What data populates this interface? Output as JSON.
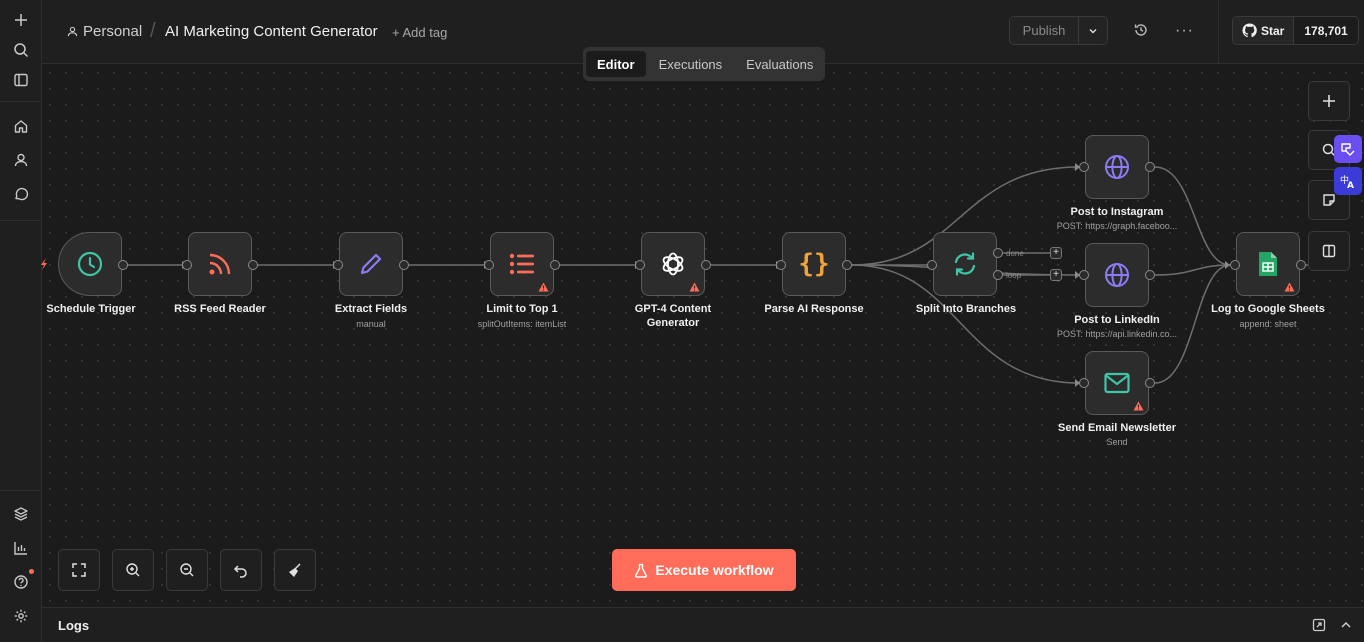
{
  "header": {
    "project": "Personal",
    "workflow_title": "AI Marketing Content Generator",
    "add_tag": "+ Add tag",
    "publish": "Publish",
    "github_star": "Star",
    "github_count": "178,701"
  },
  "tabs": [
    {
      "label": "Editor",
      "active": true
    },
    {
      "label": "Executions",
      "active": false
    },
    {
      "label": "Evaluations",
      "active": false
    }
  ],
  "nodes": [
    {
      "id": "schedule",
      "label": "Schedule Trigger",
      "sub": "",
      "icon": "clock-icon",
      "color": "#3fc5a8",
      "warning": false
    },
    {
      "id": "rss",
      "label": "RSS Feed Reader",
      "sub": "",
      "icon": "rss-icon",
      "color": "#ff6d5a",
      "warning": false
    },
    {
      "id": "extract",
      "label": "Extract Fields",
      "sub": "manual",
      "icon": "pencil-icon",
      "color": "#8b7cf6",
      "warning": false
    },
    {
      "id": "limit",
      "label": "Limit to Top 1",
      "sub": "splitOutItems: itemList",
      "icon": "list-icon",
      "color": "#ff6d5a",
      "warning": true
    },
    {
      "id": "gpt",
      "label": "GPT-4 Content Generator",
      "sub": "",
      "icon": "openai-icon",
      "color": "#ffffff",
      "warning": true
    },
    {
      "id": "parse",
      "label": "Parse AI Response",
      "sub": "",
      "icon": "braces-icon",
      "color": "#f2a23a",
      "warning": false
    },
    {
      "id": "split",
      "label": "Split Into Branches",
      "sub": "",
      "icon": "loop-icon",
      "color": "#3fc5a8",
      "warning": false
    },
    {
      "id": "instagram",
      "label": "Post to Instagram",
      "sub": "POST: https://graph.faceboo...",
      "icon": "globe-icon",
      "color": "#8b7cf6",
      "warning": false
    },
    {
      "id": "linkedin",
      "label": "Post to LinkedIn",
      "sub": "POST: https://api.linkedin.co...",
      "icon": "globe-icon",
      "color": "#8b7cf6",
      "warning": false
    },
    {
      "id": "email",
      "label": "Send Email Newsletter",
      "sub": "Send",
      "icon": "mail-icon",
      "color": "#3fc5a8",
      "warning": true
    },
    {
      "id": "sheets",
      "label": "Log to Google Sheets",
      "sub": "append: sheet",
      "icon": "sheets-icon",
      "color": "#23a566",
      "warning": true
    }
  ],
  "edge_labels": {
    "done": "done",
    "loop": "loop"
  },
  "execute_button": "Execute workflow",
  "logs": {
    "title": "Logs"
  },
  "colors": {
    "accent": "#ff6d5a",
    "warning": "#ff6d5a",
    "canvas": "#1b1b1b"
  }
}
